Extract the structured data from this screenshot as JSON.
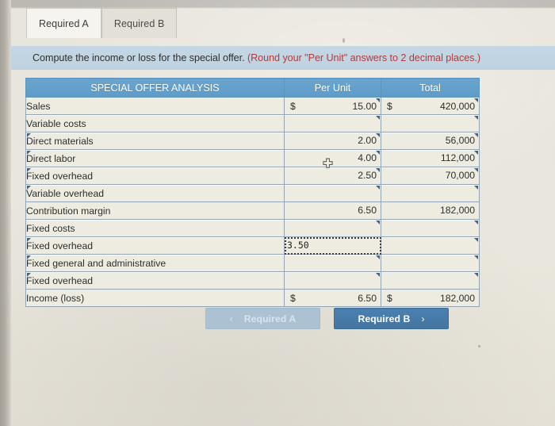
{
  "tabs": [
    {
      "label": "Required A",
      "state": "active"
    },
    {
      "label": "Required B",
      "state": "inactive"
    }
  ],
  "prompt": {
    "main": "Compute the income or loss for the special offer.",
    "note": "(Round your \"Per Unit\" answers to 2 decimal places.)"
  },
  "table": {
    "headers": {
      "title": "SPECIAL OFFER ANALYSIS",
      "per_unit": "Per Unit",
      "total": "Total"
    },
    "rows": [
      {
        "label": "Sales",
        "indent": false,
        "kind": "input",
        "per_unit_symbol": "$",
        "per_unit": "15.00",
        "total_symbol": "$",
        "total": "420,000"
      },
      {
        "label": "Variable costs",
        "indent": false,
        "kind": "input",
        "per_unit_symbol": "",
        "per_unit": "",
        "total_symbol": "",
        "total": ""
      },
      {
        "label": "Direct materials",
        "indent": true,
        "kind": "input",
        "per_unit_symbol": "",
        "per_unit": "2.00",
        "total_symbol": "",
        "total": "56,000"
      },
      {
        "label": "Direct labor",
        "indent": true,
        "kind": "input",
        "per_unit_symbol": "",
        "per_unit": "4.00",
        "total_symbol": "",
        "total": "112,000"
      },
      {
        "label": "Fixed overhead",
        "indent": true,
        "kind": "input",
        "per_unit_symbol": "",
        "per_unit": "2.50",
        "total_symbol": "",
        "total": "70,000"
      },
      {
        "label": "Variable overhead",
        "indent": true,
        "kind": "input",
        "per_unit_symbol": "",
        "per_unit": "",
        "total_symbol": "",
        "total": ""
      },
      {
        "label": "Contribution margin",
        "indent": false,
        "kind": "computed",
        "per_unit_symbol": "",
        "per_unit": "6.50",
        "total_symbol": "",
        "total": "182,000"
      },
      {
        "label": "Fixed costs",
        "indent": false,
        "kind": "input",
        "per_unit_symbol": "",
        "per_unit": "",
        "total_symbol": "",
        "total": ""
      },
      {
        "label": "Fixed overhead",
        "indent": true,
        "kind": "input",
        "per_unit_symbol": "",
        "per_unit": "3.50",
        "per_unit_editing": true,
        "total_symbol": "",
        "total": ""
      },
      {
        "label": "Fixed general and administrative",
        "indent": true,
        "kind": "input",
        "per_unit_symbol": "",
        "per_unit": "",
        "total_symbol": "",
        "total": ""
      },
      {
        "label": "Fixed overhead",
        "indent": true,
        "kind": "input",
        "per_unit_symbol": "",
        "per_unit": "",
        "total_symbol": "",
        "total": ""
      },
      {
        "label": "Income (loss)",
        "indent": false,
        "kind": "computed",
        "per_unit_symbol": "$",
        "per_unit": "6.50",
        "total_symbol": "$",
        "total": "182,000"
      }
    ]
  },
  "nav": {
    "prev_label": "Required A",
    "prev_chevron": "‹",
    "next_label": "Required B",
    "next_chevron": "›"
  },
  "cursor": {
    "icon": "move-plus-cursor"
  },
  "colors": {
    "header_blue": "#5e9cc8",
    "prompt_bar": "#bdd2e1",
    "cell_bg": "#eeece1",
    "next_button": "#44759f",
    "note_red": "#b33a3a"
  }
}
